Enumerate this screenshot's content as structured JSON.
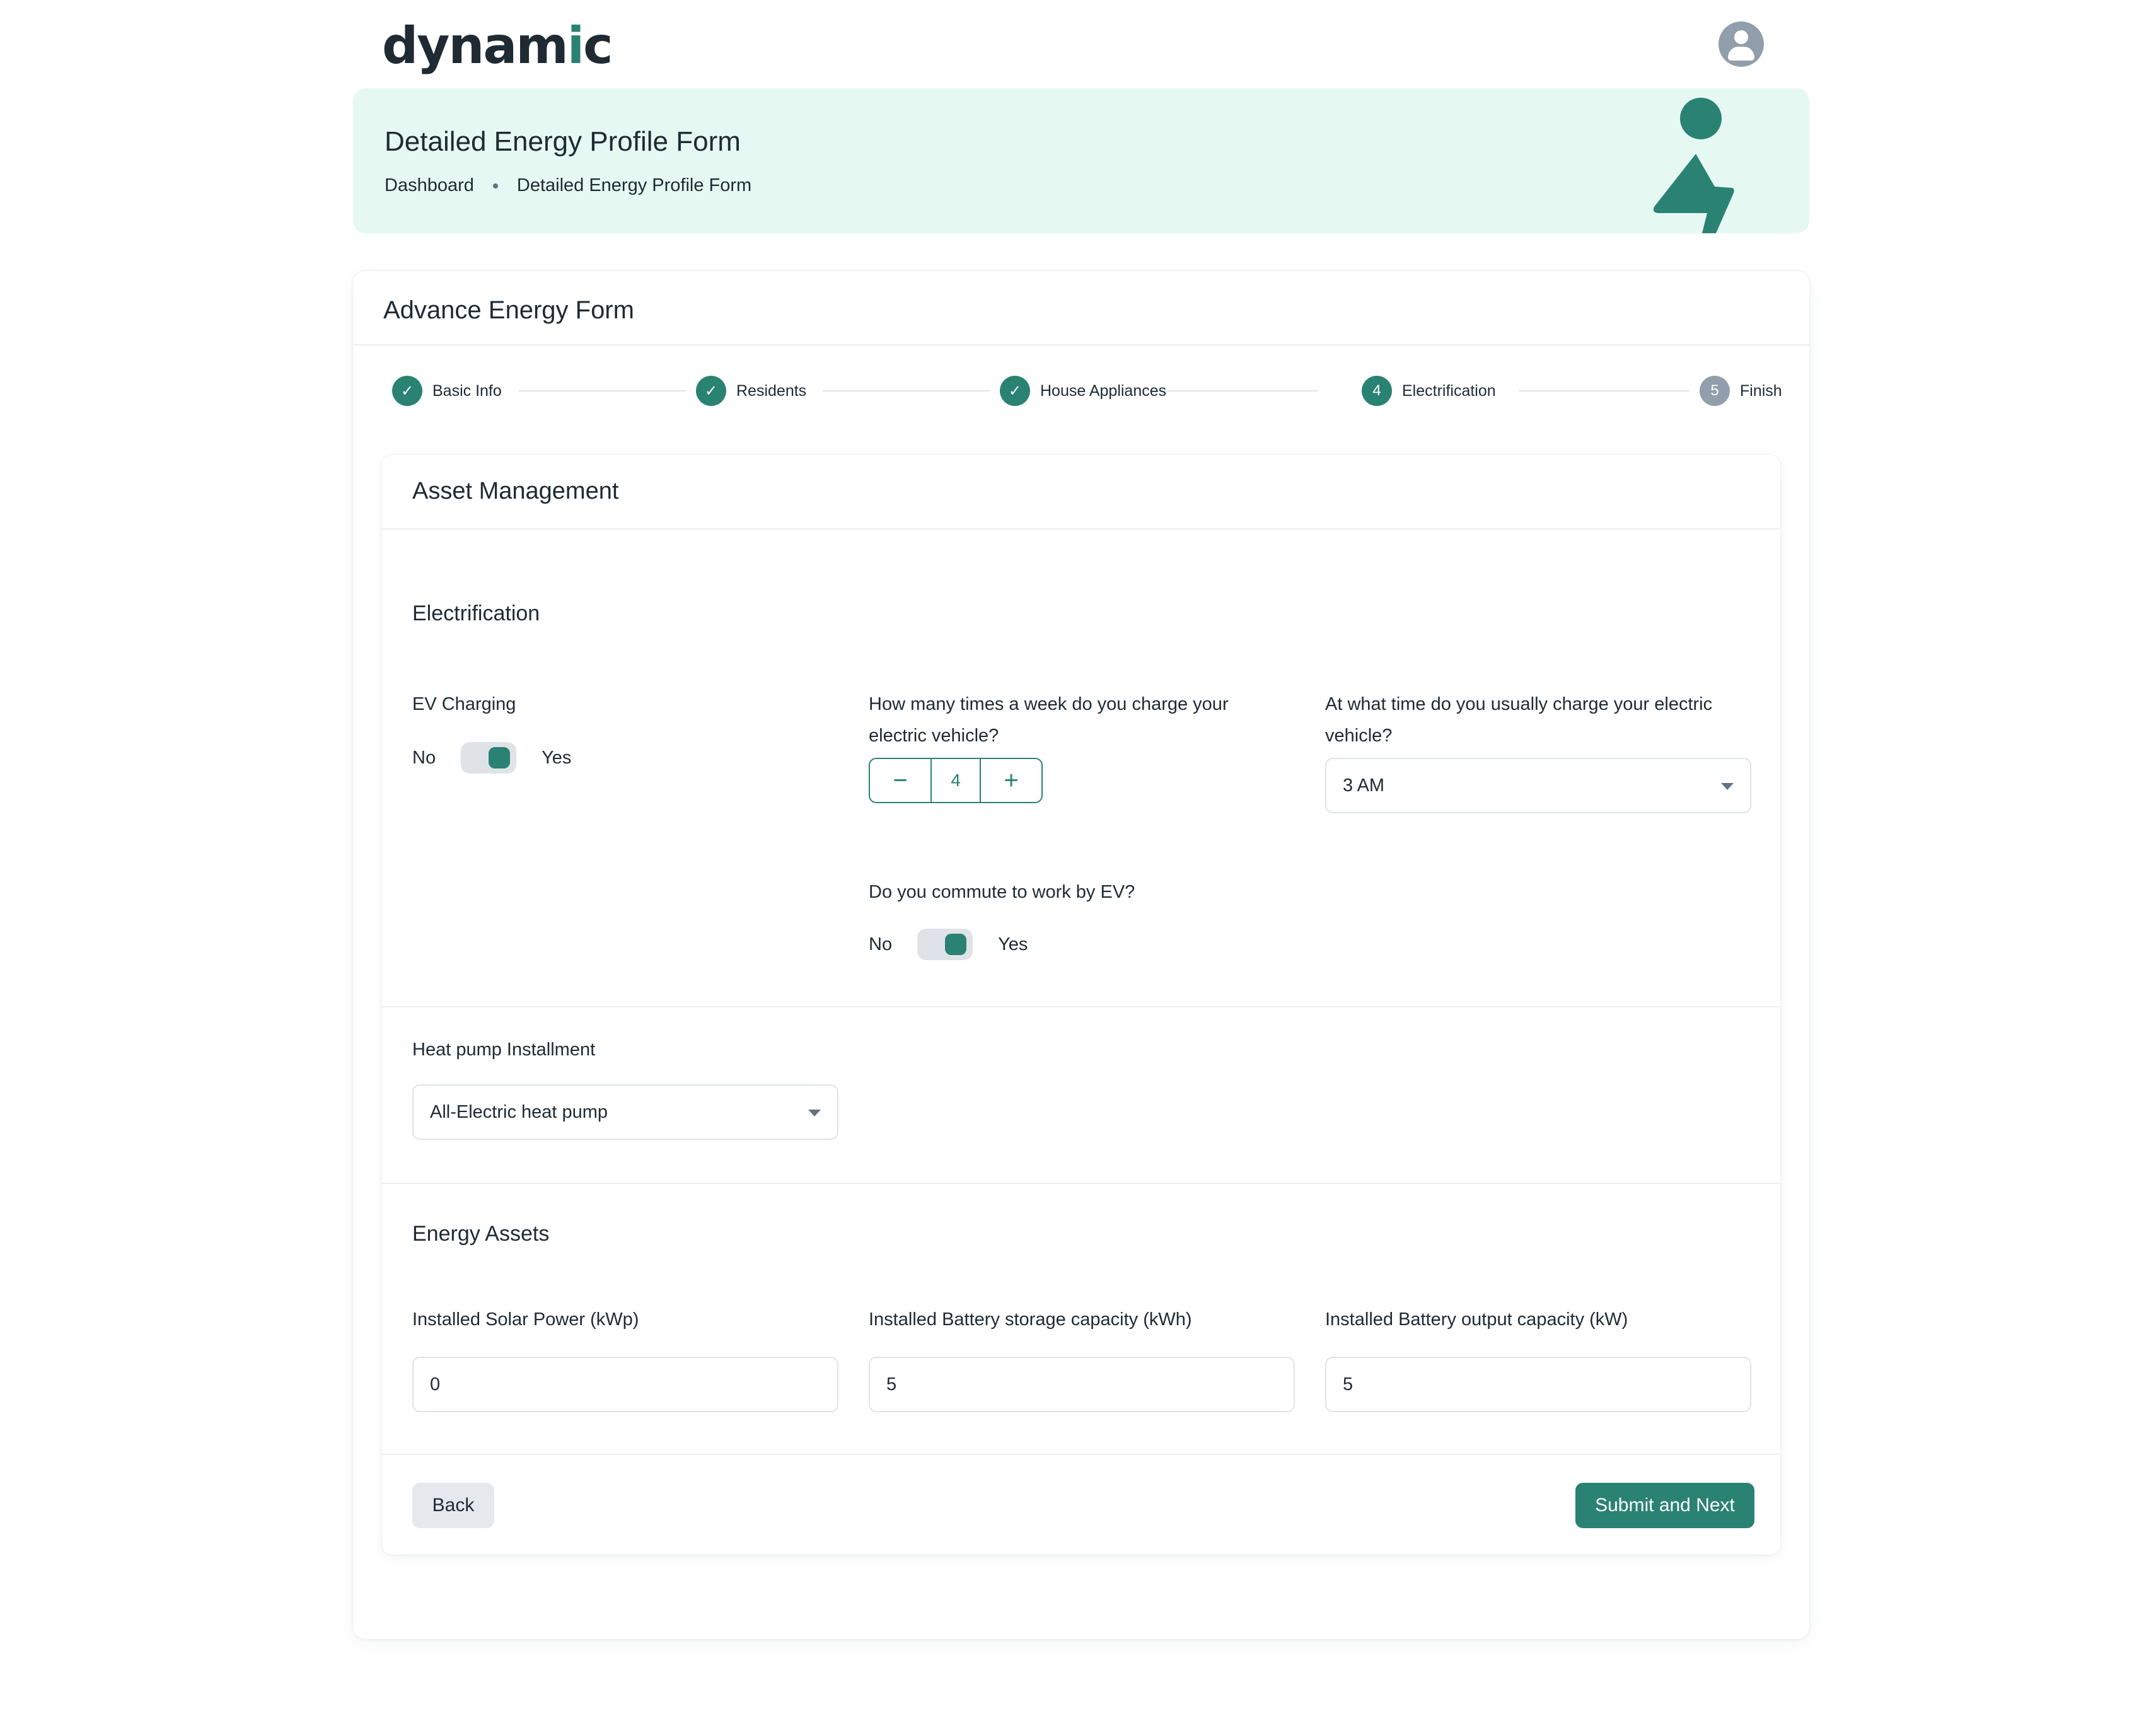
{
  "brand": {
    "logo_text_pre": "dynam",
    "logo_text_accent": "i",
    "logo_text_post": "c",
    "accent_color": "#2a8272",
    "hero_bg": "#e5f9f2"
  },
  "header": {
    "avatar_icon": "user-avatar-icon"
  },
  "hero": {
    "title": "Detailed Energy Profile Form",
    "breadcrumbs": [
      "Dashboard",
      "Detailed Energy Profile Form"
    ]
  },
  "card": {
    "title": "Advance Energy Form"
  },
  "stepper": {
    "steps": [
      {
        "label": "Basic Info",
        "state": "done",
        "marker": "✓"
      },
      {
        "label": "Residents",
        "state": "done",
        "marker": "✓"
      },
      {
        "label": "House Appliances",
        "state": "done",
        "marker": "✓"
      },
      {
        "label": "Electrification",
        "state": "active",
        "marker": "4"
      },
      {
        "label": "Finish",
        "state": "pending",
        "marker": "5"
      }
    ]
  },
  "form": {
    "title": "Asset Management",
    "electrification": {
      "title": "Electrification",
      "ev_charging": {
        "label": "EV Charging",
        "off": "No",
        "on": "Yes",
        "value": true
      },
      "charge_frequency": {
        "label_line1": "How many times a week do you charge your",
        "label_line2": "electric vehicle?",
        "value": "4",
        "minus": "−",
        "plus": "+"
      },
      "charge_time": {
        "label_line1": "At what time do you usually charge your electric",
        "label_line2": "vehicle?",
        "value": "3 AM"
      },
      "commute": {
        "label": "Do you commute to work by EV?",
        "off": "No",
        "on": "Yes",
        "value": true
      }
    },
    "heat_pump": {
      "label": "Heat pump Installment",
      "value": "All-Electric heat pump"
    },
    "energy_assets": {
      "title": "Energy Assets",
      "solar": {
        "label": "Installed Solar Power (kWp)",
        "value": "0"
      },
      "battery_storage": {
        "label": "Installed Battery storage capacity (kWh)",
        "value": "5"
      },
      "battery_output": {
        "label": "Installed Battery output capacity (kW)",
        "value": "5"
      }
    },
    "actions": {
      "back": "Back",
      "submit": "Submit and Next"
    }
  }
}
